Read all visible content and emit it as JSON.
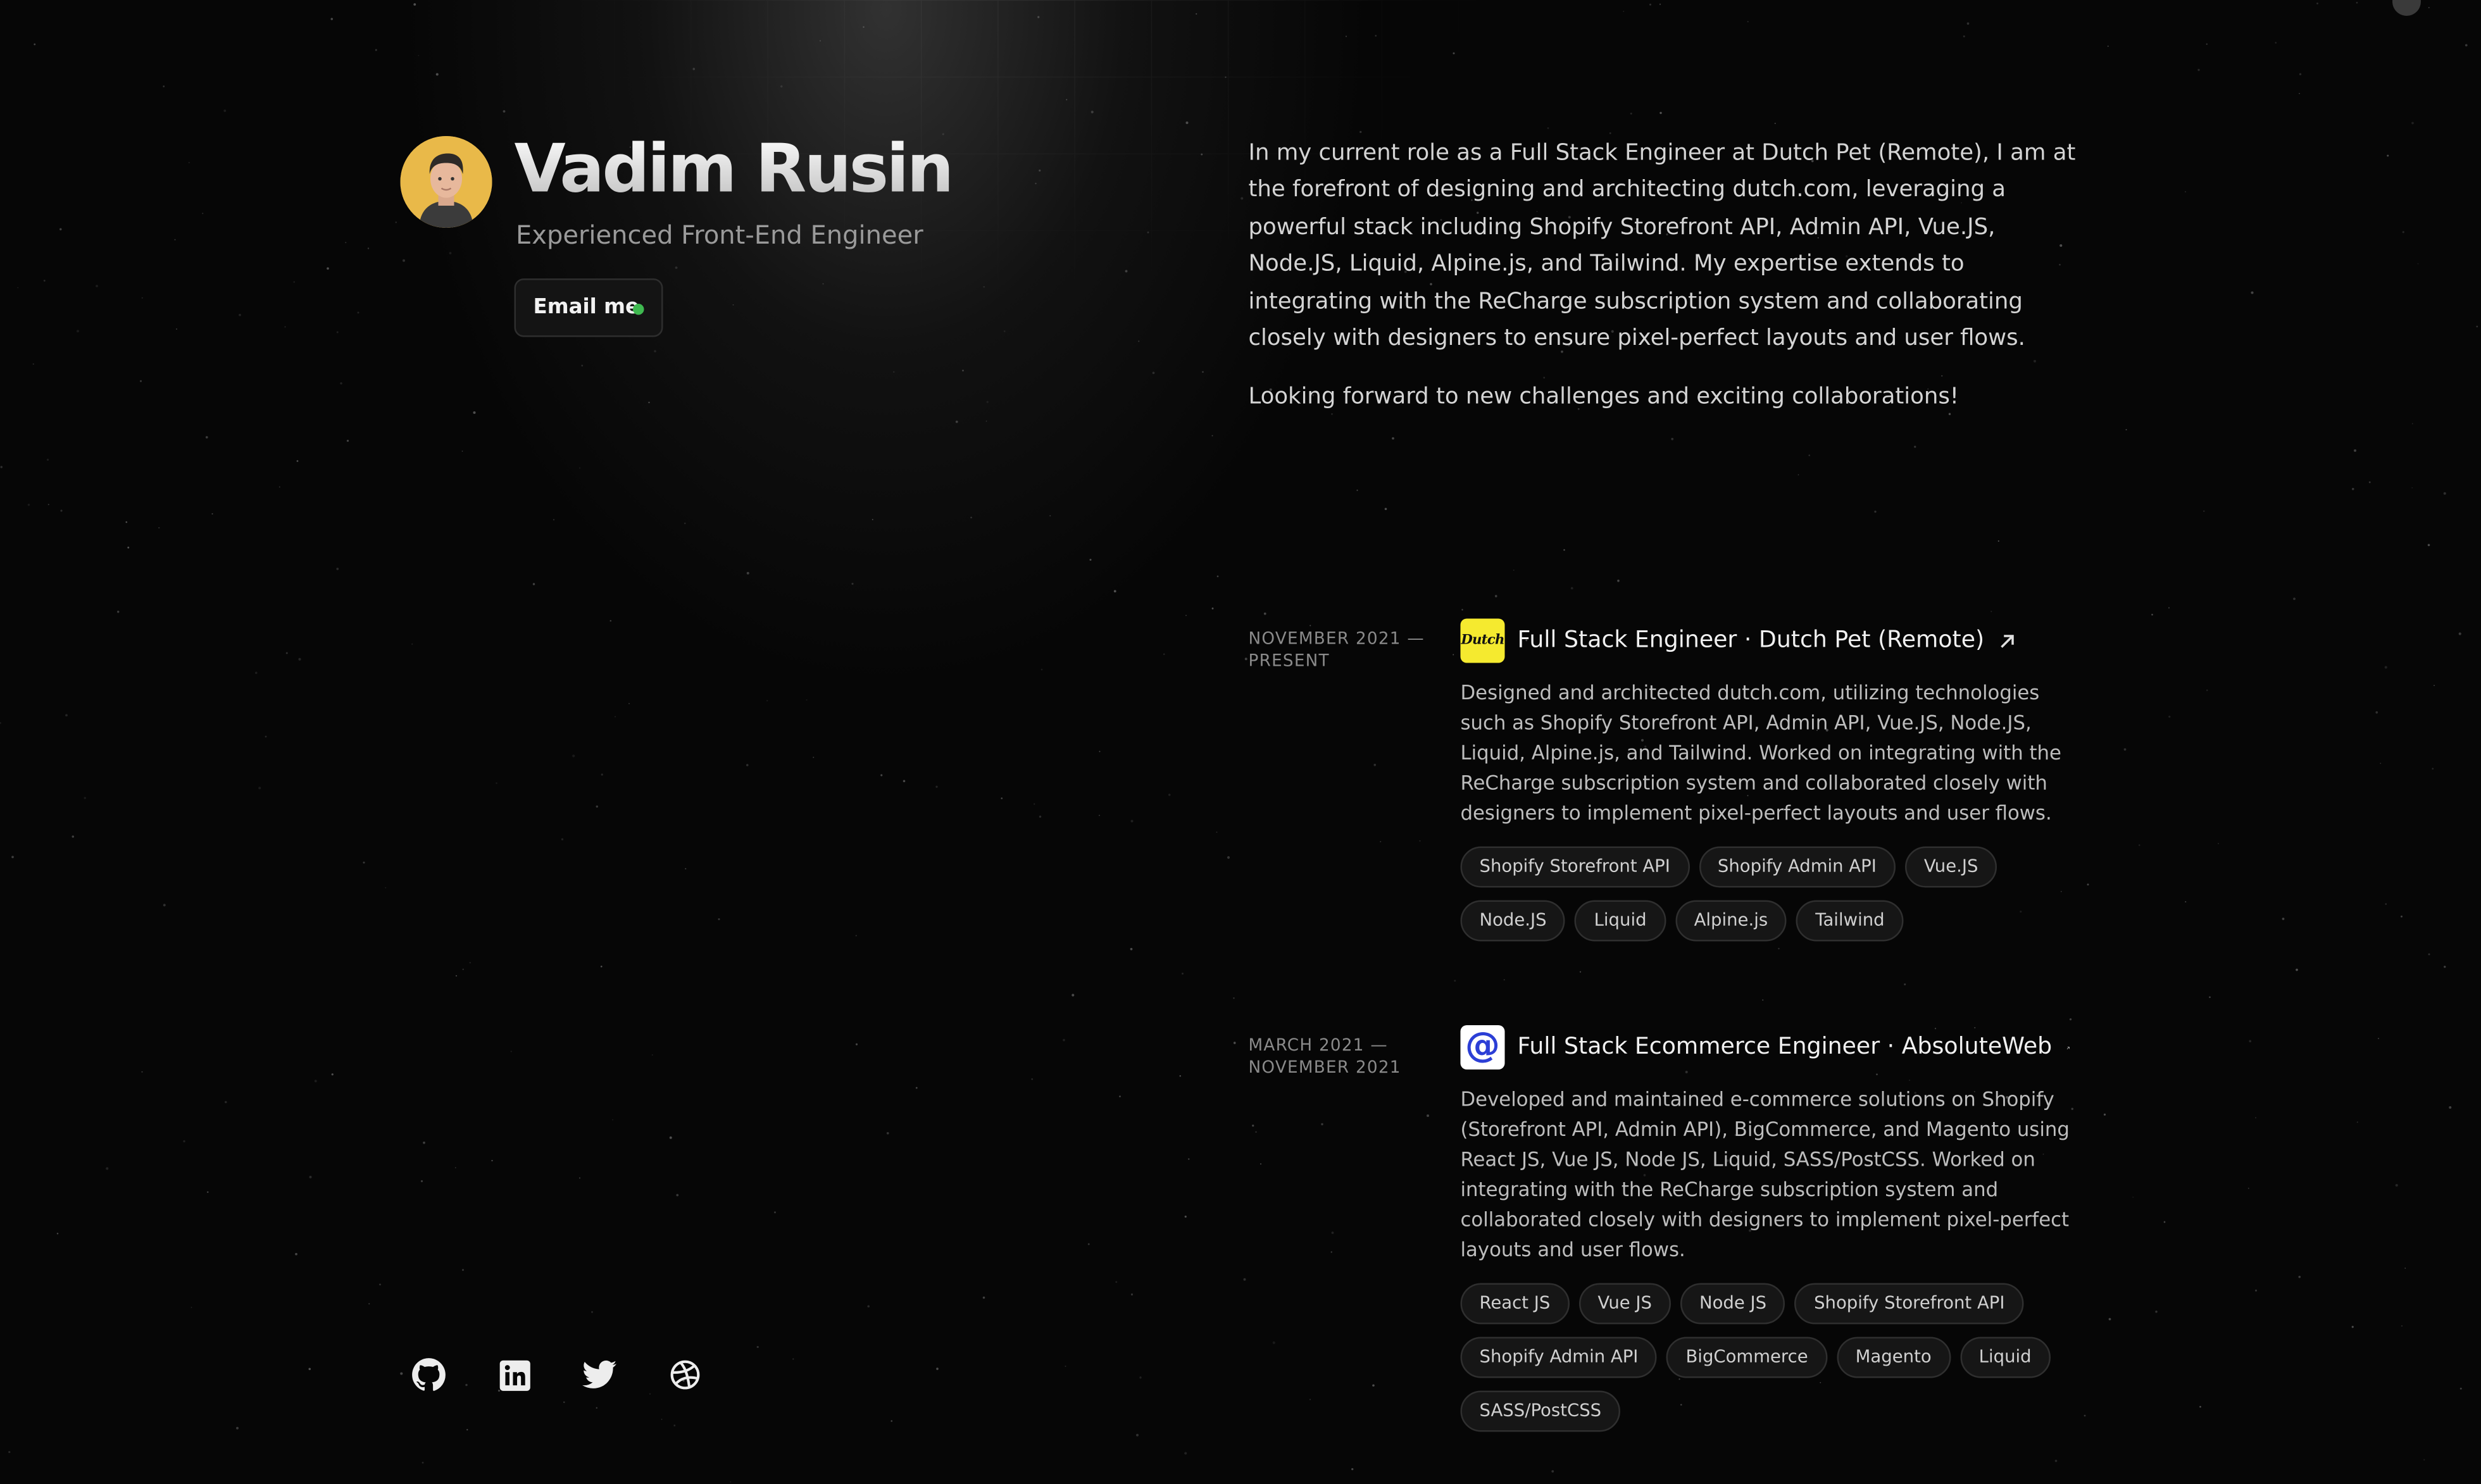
{
  "profile": {
    "name": "Vadim Rusin",
    "tagline": "Experienced Front-End Engineer",
    "email_button": "Email me",
    "status_color": "#3fb950"
  },
  "about": {
    "paragraphs": [
      "In my current role as a Full Stack Engineer at Dutch Pet (Remote), I am at the forefront of designing and architecting dutch.com, leveraging a powerful stack including Shopify Storefront API, Admin API, Vue.JS, Node.JS, Liquid, Alpine.js, and Tailwind. My expertise extends to integrating with the ReCharge subscription system and collaborating closely with designers to ensure pixel-perfect layouts and user flows.",
      "Looking forward to new challenges and exciting collaborations!"
    ]
  },
  "experience": [
    {
      "date": "November 2021 — Present",
      "logo_icon": "dutch-logo-icon",
      "logo_text": "Dutch",
      "title": "Full Stack Engineer · Dutch Pet (Remote)",
      "description": "Designed and architected dutch.com, utilizing technologies such as Shopify Storefront API, Admin API, Vue.JS, Node.JS, Liquid, Alpine.js, and Tailwind. Worked on integrating with the ReCharge subscription system and collaborated closely with designers to implement pixel-perfect layouts and user flows.",
      "tags": [
        "Shopify Storefront API",
        "Shopify Admin API",
        "Vue.JS",
        "Node.JS",
        "Liquid",
        "Alpine.js",
        "Tailwind"
      ]
    },
    {
      "date": "March 2021 — November 2021",
      "logo_icon": "at-sign-logo-icon",
      "logo_text": "@",
      "title": "Full Stack Ecommerce Engineer · AbsoluteWeb",
      "description": "Developed and maintained e-commerce solutions on Shopify (Storefront API, Admin API), BigCommerce, and Magento using React JS, Vue JS, Node JS, Liquid, SASS/PostCSS. Worked on integrating with the ReCharge subscription system and collaborated closely with designers to implement pixel-perfect layouts and user flows.",
      "tags": [
        "React JS",
        "Vue JS",
        "Node JS",
        "Shopify Storefront API",
        "Shopify Admin API",
        "BigCommerce",
        "Magento",
        "Liquid",
        "SASS/PostCSS"
      ]
    }
  ],
  "socials": [
    "github-icon",
    "linkedin-icon",
    "twitter-icon",
    "dribbble-icon"
  ],
  "colors": {
    "background": "#060606",
    "text": "#e5e5e5",
    "muted": "#9a9a9a",
    "dutch_logo": "#f5ea2f",
    "absoluteweb_logo": "#2c3fd6"
  }
}
